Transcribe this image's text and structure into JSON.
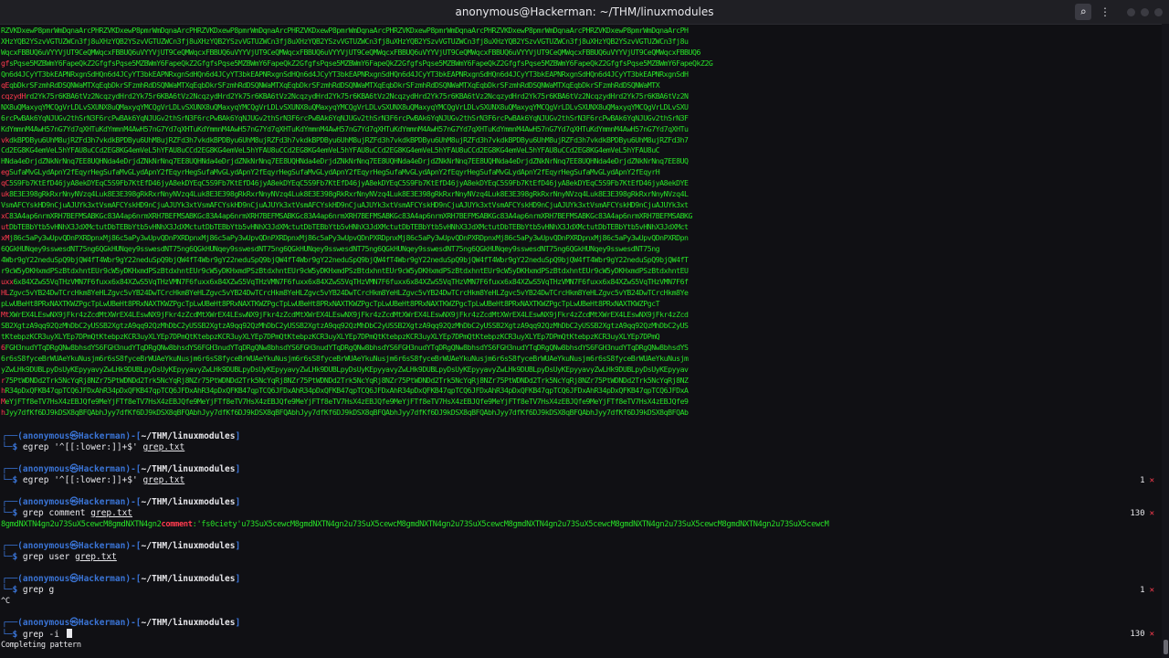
{
  "window": {
    "title": "anonymous@Hackerman: ~/THM/linuxmodules"
  },
  "dump_lines": [
    "RZVKDxewP8pmrWmDqnaArcPHRZVKDxewP8pmrWmDqnaArcPHRZVKDxewP8pmrWmDqnaArcPHRZVKDxewP8pmrWmDqnaArcPHRZVKDxewP8pmrWmDqnaArcPHRZVKDxewP8pmrWmDqnaArcPHRZVKDxewP8pmrWmDqnaArcPH",
    "XHzYQB2YSzvVGTUZWCn3fj8uXHzYQB2YSzvVGTUZWCn3fj8uXHzYQB2YSzvVGTUZWCn3fj8uXHzYQB2YSzvVGTUZWCn3fj8uXHzYQB2YSzvVGTUZWCn3fj8uXHzYQB2YSzvVGTUZWCn3fj8uXHzYQB2YSzvVGTUZWCn3fj8u",
    "WqcxFBBUQ6uVYYVjUT9CeQMWqcxFBBUQ6uVYYVjUT9CeQMWqcxFBBUQ6uVYYVjUT9CeQMWqcxFBBUQ6uVYYVjUT9CeQMWqcxFBBUQ6uVYYVjUT9CeQMWqcxFBBUQ6uVYYVjUT9CeQMWqcxFBBUQ6uVYYVjUT9CeQMWqcxFBBUQ6",
    "gfsPqse5MZBWmY6FapeQkZ2GfgfsPqse5MZBWmY6FapeQkZ2GfgfsPqse5MZBWmY6FapeQkZ2GfgfsPqse5MZBWmY6FapeQkZ2GfgfsPqse5MZBWmY6FapeQkZ2GfgfsPqse5MZBWmY6FapeQkZ2GfgfsPqse5MZBWmY6FapeQkZ2G",
    "Qn6d4JCyYT3bkEAPNRxgnSdHQn6d4JCyYT3bkEAPNRxgnSdHQn6d4JCyYT3bkEAPNRxgnSdHQn6d4JCyYT3bkEAPNRxgnSdHQn6d4JCyYT3bkEAPNRxgnSdHQn6d4JCyYT3bkEAPNRxgnSdHQn6d4JCyYT3bkEAPNRxgnSdH",
    "qEqbDkrSFzmhRdDSQNWaMTXqEqbDkrSFzmhRdDSQNWaMTXqEqbDkrSFzmhRdDSQNWaMTXqEqbDkrSFzmhRdDSQNWaMTXqEqbDkrSFzmhRdDSQNWaMTXqEqbDkrSFzmhRdDSQNWaMTXqEqbDkrSFzmhRdDSQNWaMTX",
    "cqzydHrd2Yk75r6KBA6tVz2NcqzydHrd2Yk75r6KBA6tVz2NcqzydHrd2Yk75r6KBA6tVz2NcqzydHrd2Yk75r6KBA6tVz2NcqzydHrd2Yk75r6KBA6tVz2NcqzydHrd2Yk75r6KBA6tVz2NcqzydHrd2Yk75r6KBA6tVz2N",
    "NX8uQMaxyqYMCQgVrLDLvSXUNX8uQMaxyqYMCQgVrLDLvSXUNX8uQMaxyqYMCQgVrLDLvSXUNX8uQMaxyqYMCQgVrLDLvSXUNX8uQMaxyqYMCQgVrLDLvSXUNX8uQMaxyqYMCQgVrLDLvSXUNX8uQMaxyqYMCQgVrLDLvSXU",
    "6rcPwBAk6YqNJUGv2thSrN3F6rcPwBAk6YqNJUGv2thSrN3F6rcPwBAk6YqNJUGv2thSrN3F6rcPwBAk6YqNJUGv2thSrN3F6rcPwBAk6YqNJUGv2thSrN3F6rcPwBAk6YqNJUGv2thSrN3F6rcPwBAk6YqNJUGv2thSrN3F",
    "KdYmmnM4AwH57nG7Yd7qXHTuKdYmmnM4AwH57nG7Yd7qXHTuKdYmmnM4AwH57nG7Yd7qXHTuKdYmmnM4AwH57nG7Yd7qXHTuKdYmmnM4AwH57nG7Yd7qXHTuKdYmmnM4AwH57nG7Yd7qXHTuKdYmmnM4AwH57nG7Yd7qXHTu",
    "vkdkBPDByu6UhM8ujRZFd3h7vkdkBPDByu6UhM8ujRZFd3h7vkdkBPDByu6UhM8ujRZFd3h7vkdkBPDByu6UhM8ujRZFd3h7vkdkBPDByu6UhM8ujRZFd3h7vkdkBPDByu6UhM8ujRZFd3h7vkdkBPDByu6UhM8ujRZFd3h7",
    "Cd2EG8KG4emVeL5hYFAU8uCCd2EG8KG4emVeL5hYFAU8uCCd2EG8KG4emVeL5hYFAU8uCCd2EG8KG4emVeL5hYFAU8uCCd2EG8KG4emVeL5hYFAU8uCCd2EG8KG4emVeL5hYFAU8uCCd2EG8KG4emVeL5hYFAU8uC",
    "HNda4eDrjdZNkNrNnq7EE8UQHNda4eDrjdZNkNrNnq7EE8UQHNda4eDrjdZNkNrNnq7EE8UQHNda4eDrjdZNkNrNnq7EE8UQHNda4eDrjdZNkNrNnq7EE8UQHNda4eDrjdZNkNrNnq7EE8UQHNda4eDrjdZNkNrNnq7EE8UQ",
    "egSufaMvGLydApnY2fEqyrHegSufaMvGLydApnY2fEqyrHegSufaMvGLydApnY2fEqyrHegSufaMvGLydApnY2fEqyrHegSufaMvGLydApnY2fEqyrHegSufaMvGLydApnY2fEqyrHegSufaMvGLydApnY2fEqyrH",
    "qC5S9Fb7KtEfD46jyA8ekDYEqC5S9Fb7KtEfD46jyA8ekDYEqC5S9Fb7KtEfD46jyA8ekDYEqC5S9Fb7KtEfD46jyA8ekDYEqC5S9Fb7KtEfD46jyA8ekDYEqC5S9Fb7KtEfD46jyA8ekDYEqC5S9Fb7KtEfD46jyA8ekDYE",
    "uk8E3E398gRkRxrNnyNVzq4Luk8E3E398gRkRxrNnyNVzq4Luk8E3E398gRkRxrNnyNVzq4Luk8E3E398gRkRxrNnyNVzq4Luk8E3E398gRkRxrNnyNVzq4Luk8E3E398gRkRxrNnyNVzq4Luk8E3E398gRkRxrNnyNVzq4L",
    "VsmAFCYskHD9nCjuAJUYk3xtVsmAFCYskHD9nCjuAJUYk3xtVsmAFCYskHD9nCjuAJUYk3xtVsmAFCYskHD9nCjuAJUYk3xtVsmAFCYskHD9nCjuAJUYk3xtVsmAFCYskHD9nCjuAJUYk3xtVsmAFCYskHD9nCjuAJUYk3xt",
    "xC83A4ap6nrmXRH7BEFMSABKGc83A4ap6nrmXRH7BEFMSABKGc83A4ap6nrmXRH7BEFMSABKGc83A4ap6nrmXRH7BEFMSABKGc83A4ap6nrmXRH7BEFMSABKGc83A4ap6nrmXRH7BEFMSABKGc83A4ap6nrmXRH7BEFMSABKG",
    "utDbTEBbYtb5vHNhX3JdXMctutDbTEBbYtb5vHNhX3JdXMctutDbTEBbYtb5vHNhX3JdXMctutDbTEBbYtb5vHNhX3JdXMctutDbTEBbYtb5vHNhX3JdXMctutDbTEBbYtb5vHNhX3JdXMctutDbTEBbYtb5vHNhX3JdXMct",
    "xMj86c5aPy3wUpvQDnPXRDpnxMj86c5aPy3wUpvQDnPXRDpnxMj86c5aPy3wUpvQDnPXRDpnxMj86c5aPy3wUpvQDnPXRDpnxMj86c5aPy3wUpvQDnPXRDpnxMj86c5aPy3wUpvQDnPXRDpnxMj86c5aPy3wUpvQDnPXRDpn",
    "6QGkHUNqey9sswesdNT75ng6QGkHUNqey9sswesdNT75ng6QGkHUNqey9sswesdNT75ng6QGkHUNqey9sswesdNT75ng6QGkHUNqey9sswesdNT75ng6QGkHUNqey9sswesdNT75ng6QGkHUNqey9sswesdNT75ng",
    "4Wbr9gY22neduSpQ9bjQW4fT4Wbr9gY22neduSpQ9bjQW4fT4Wbr9gY22neduSpQ9bjQW4fT4Wbr9gY22neduSpQ9bjQW4fT4Wbr9gY22neduSpQ9bjQW4fT4Wbr9gY22neduSpQ9bjQW4fT4Wbr9gY22neduSpQ9bjQW4fT",
    "r9cW5yDKHxmdPSzBtdxhntEUr9cW5yDKHxmdPSzBtdxhntEUr9cW5yDKHxmdPSzBtdxhntEUr9cW5yDKHxmdPSzBtdxhntEUr9cW5yDKHxmdPSzBtdxhntEUr9cW5yDKHxmdPSzBtdxhntEUr9cW5yDKHxmdPSzBtdxhntEU",
    "uxx6x84XZwS5VqTHzVMN7F6fuxx6x84XZwS5VqTHzVMN7F6fuxx6x84XZwS5VqTHzVMN7F6fuxx6x84XZwS5VqTHzVMN7F6fuxx6x84XZwS5VqTHzVMN7F6fuxx6x84XZwS5VqTHzVMN7F6fuxx6x84XZwS5VqTHzVMN7F6f",
    "HLZgvc5vYB24DwTCrcHkm8YeHLZgvc5vYB24DwTCrcHkm8YeHLZgvc5vYB24DwTCrcHkm8YeHLZgvc5vYB24DwTCrcHkm8YeHLZgvc5vYB24DwTCrcHkm8YeHLZgvc5vYB24DwTCrcHkm8YeHLZgvc5vYB24DwTCrcHkm8Ye",
    "pLwUBeHt8PRxNAXTKWZPgcTpLwUBeHt8PRxNAXTKWZPgcTpLwUBeHt8PRxNAXTKWZPgcTpLwUBeHt8PRxNAXTKWZPgcTpLwUBeHt8PRxNAXTKWZPgcTpLwUBeHt8PRxNAXTKWZPgcTpLwUBeHt8PRxNAXTKWZPgcT",
    "MtXWrEX4LEswNX9jFkr4zZcdMtXWrEX4LEswNX9jFkr4zZcdMtXWrEX4LEswNX9jFkr4zZcdMtXWrEX4LEswNX9jFkr4zZcdMtXWrEX4LEswNX9jFkr4zZcdMtXWrEX4LEswNX9jFkr4zZcdMtXWrEX4LEswNX9jFkr4zZcd",
    "SB2XgtzA9qq92QzMhDbC2yUSSB2XgtzA9qq92QzMhDbC2yUSSB2XgtzA9qq92QzMhDbC2yUSSB2XgtzA9qq92QzMhDbC2yUSSB2XgtzA9qq92QzMhDbC2yUSSB2XgtzA9qq92QzMhDbC2yUSSB2XgtzA9qq92QzMhDbC2yUS",
    "tKtebpzKCR3uyXLYEp7DPmQtKtebpzKCR3uyXLYEp7DPmQtKtebpzKCR3uyXLYEp7DPmQtKtebpzKCR3uyXLYEp7DPmQtKtebpzKCR3uyXLYEp7DPmQtKtebpzKCR3uyXLYEp7DPmQtKtebpzKCR3uyXLYEp7DPmQ",
    "6FGH3nudYTqDRgQNw8bhsdYS6FGH3nudYTqDRgQNw8bhsdYS6FGH3nudYTqDRgQNw8bhsdYS6FGH3nudYTqDRgQNw8bhsdYS6FGH3nudYTqDRgQNw8bhsdYS6FGH3nudYTqDRgQNw8bhsdYS6FGH3nudYTqDRgQNw8bhsdYS",
    "6r6sS8fyceBrWUAeYkuNusjm6r6sS8fyceBrWUAeYkuNusjm6r6sS8fyceBrWUAeYkuNusjm6r6sS8fyceBrWUAeYkuNusjm6r6sS8fyceBrWUAeYkuNusjm6r6sS8fyceBrWUAeYkuNusjm6r6sS8fyceBrWUAeYkuNusjm",
    "yZwLHk9DUBLpyDsUyKEpyyavyZwLHk9DUBLpyDsUyKEpyyavyZwLHk9DUBLpyDsUyKEpyyavyZwLHk9DUBLpyDsUyKEpyyavyZwLHk9DUBLpyDsUyKEpyyavyZwLHk9DUBLpyDsUyKEpyyavyZwLHk9DUBLpyDsUyKEpyyav",
    "r75PtWDNDd2Trk5NcYqRj8NZr75PtWDNDd2Trk5NcYqRj8NZr75PtWDNDd2Trk5NcYqRj8NZr75PtWDNDd2Trk5NcYqRj8NZr75PtWDNDd2Trk5NcYqRj8NZr75PtWDNDd2Trk5NcYqRj8NZr75PtWDNDd2Trk5NcYqRj8NZ",
    "hR34pDxQFKB47qpTCQ6JFDxAhR34pDxQFKB47qpTCQ6JFDxAhR34pDxQFKB47qpTCQ6JFDxAhR34pDxQFKB47qpTCQ6JFDxAhR34pDxQFKB47qpTCQ6JFDxAhR34pDxQFKB47qpTCQ6JFDxAhR34pDxQFKB47qpTCQ6JFDxA",
    "MeYjFTf8eTV7HsX4zEBJQfe9MeYjFTf8eTV7HsX4zEBJQfe9MeYjFTf8eTV7HsX4zEBJQfe9MeYjFTf8eTV7HsX4zEBJQfe9MeYjFTf8eTV7HsX4zEBJQfe9MeYjFTf8eTV7HsX4zEBJQfe9MeYjFTf8eTV7HsX4zEBJQfe9",
    "hJyy7dfKf6DJ9kDSX8qBFQAbhJyy7dfKf6DJ9kDSX8qBFQAbhJyy7dfKf6DJ9kDSX8qBFQAbhJyy7dfKf6DJ9kDSX8qBFQAbhJyy7dfKf6DJ9kDSX8qBFQAbhJyy7dfKf6DJ9kDSX8qBFQAbhJyy7dfKf6DJ9kDSX8qBFQAb"
  ],
  "prompt": {
    "corner_top": "┌──(",
    "user": "anonymous㉿Hackerman",
    "sep": ")-[",
    "path": "~/THM/linuxmodules",
    "close": "]",
    "corner_bottom": "└─$ "
  },
  "commands": [
    {
      "cmd": "egrep '^[[:lower:]]+$' ",
      "file": "grep.txt",
      "status_code": "",
      "output": ""
    },
    {
      "cmd": "egrep '^[[:lower:]]+$' ",
      "file": "grep.txt",
      "status_code": "1",
      "output": ""
    },
    {
      "cmd": "grep comment ",
      "file": "grep.txt",
      "status_code": "130",
      "output_pre": "8gmdNXTN4gn2u73SuX5cewcM8gmdNXTN4gn2",
      "output_kw": "comment",
      "output_post": ":'fs0ciety'u73SuX5cewcM8gmdNXTN4gn2u73SuX5cewcM8gmdNXTN4gn2u73SuX5cewcM8gmdNXTN4gn2u73SuX5cewcM8gmdNXTN4gn2u73SuX5cewcM8gmdNXTN4gn2u73SuX5cewcM"
    },
    {
      "cmd": "grep user ",
      "file": "grep.txt",
      "status_code": "",
      "output": ""
    },
    {
      "cmd": "grep g",
      "file": "",
      "status_code": "1",
      "output": "^C"
    },
    {
      "cmd": "grep -i ",
      "file": "",
      "status_code": "130",
      "output": "Completing pattern"
    }
  ],
  "status_x": "✕",
  "colors": {
    "prompt_blue": "#3a74d6",
    "match_green": "#27e227",
    "highlight_red": "#ff3b4e"
  }
}
